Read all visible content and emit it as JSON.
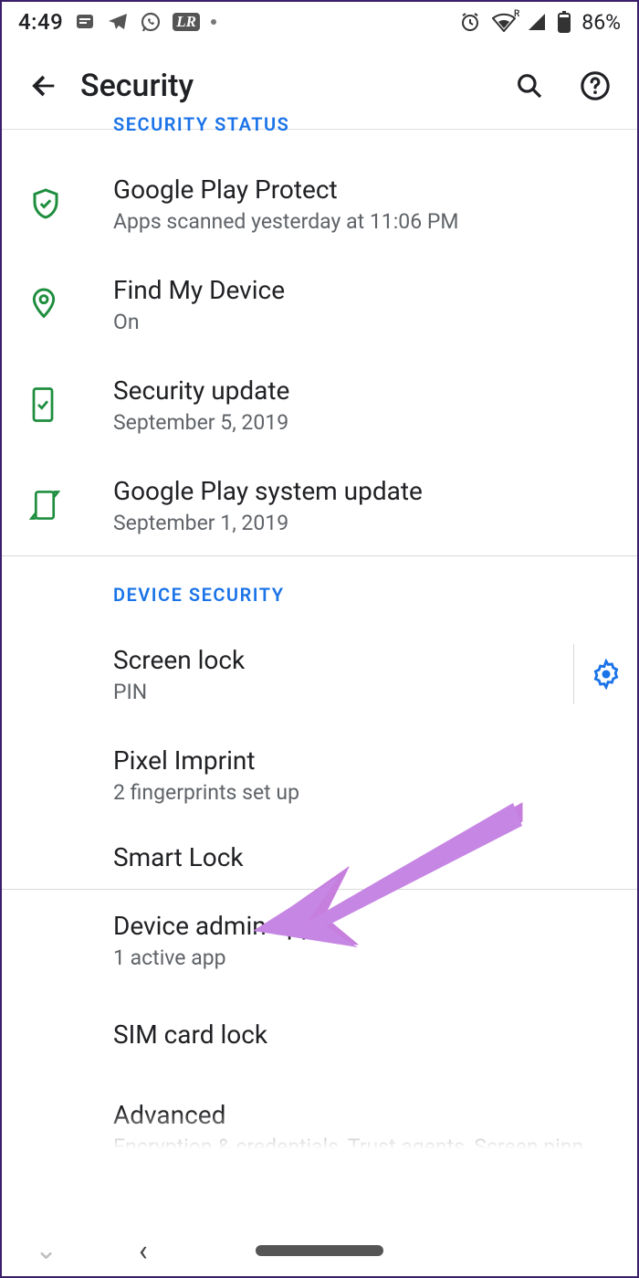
{
  "status": {
    "time": "4:49",
    "battery": "86%"
  },
  "header": {
    "title": "Security"
  },
  "sections": {
    "security_status_label": "SECURITY STATUS",
    "device_security_label": "DEVICE SECURITY"
  },
  "items": {
    "play_protect": {
      "title": "Google Play Protect",
      "subtitle": "Apps scanned yesterday at 11:06 PM"
    },
    "find_device": {
      "title": "Find My Device",
      "subtitle": "On"
    },
    "sec_update": {
      "title": "Security update",
      "subtitle": "September 5, 2019"
    },
    "play_update": {
      "title": "Google Play system update",
      "subtitle": "September 1, 2019"
    },
    "screen_lock": {
      "title": "Screen lock",
      "subtitle": "PIN"
    },
    "pixel_imprint": {
      "title": "Pixel Imprint",
      "subtitle": "2 fingerprints set up"
    },
    "smart_lock": {
      "title": "Smart Lock"
    },
    "admin_apps": {
      "title": "Device admin apps",
      "subtitle": "1 active app"
    },
    "sim_lock": {
      "title": "SIM card lock"
    },
    "advanced": {
      "title": "Advanced",
      "subtitle": "Encryption & credentials, Trust agents, Screen pinn…"
    }
  }
}
